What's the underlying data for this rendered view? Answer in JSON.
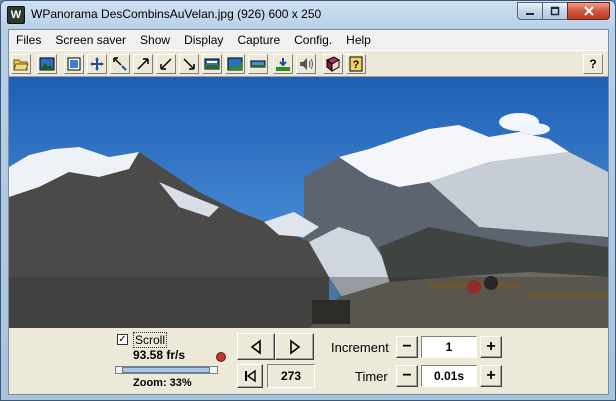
{
  "window": {
    "app_name": "WPanorama",
    "title": "WPanorama  DesCombinsAuVelan.jpg   (926) 600 x 250",
    "icon": "wpanorama-app-icon",
    "controls": [
      "minimize-icon",
      "maximize-icon",
      "close-icon"
    ]
  },
  "menu": {
    "items": [
      {
        "label": "Files"
      },
      {
        "label": "Screen saver"
      },
      {
        "label": "Show"
      },
      {
        "label": "Display"
      },
      {
        "label": "Capture"
      },
      {
        "label": "Config."
      },
      {
        "label": "Help"
      }
    ]
  },
  "toolbar": {
    "help_label": "?",
    "icons": [
      "open-folder-icon",
      "image-icon",
      "fit-window-icon",
      "move-arrows-icon",
      "shrink-arrows-icon",
      "expand-ne-icon",
      "shrink-sw-icon",
      "expand-se-icon",
      "image-adjust-icon",
      "image-level-icon",
      "image-strip-icon",
      "horizon-icon",
      "sound-icon",
      "book-icon",
      "help-book-icon",
      "help-icon"
    ]
  },
  "panel": {
    "scroll_label": "Scroll",
    "scroll_checked": true,
    "check_mark": "✓",
    "fps": "93.58 fr/s",
    "zoom_label": "Zoom: 33%",
    "zoom_value": 33,
    "frame": "273",
    "increment_label": "Increment",
    "increment_value": "1",
    "timer_label": "Timer",
    "timer_value": "0.01s",
    "minus": "−",
    "plus": "+"
  },
  "colors": {
    "sky": "#2f74c8",
    "window_frame": "#b7cfe6",
    "panel_bg": "#ece9d8",
    "close_button": "#d1573f"
  }
}
